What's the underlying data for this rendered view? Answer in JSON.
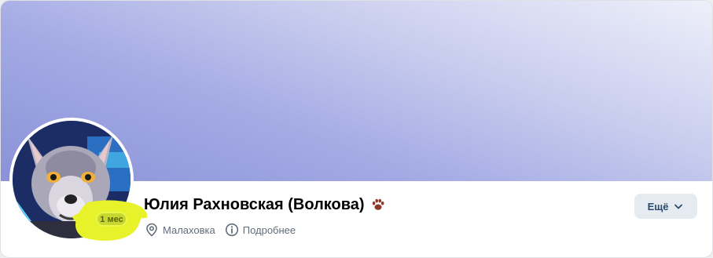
{
  "profile": {
    "name": "Юлия Рахновская (Волкова)",
    "status_badge": "1 мес",
    "location": "Малаховка",
    "details_link": "Подробнее"
  },
  "actions": {
    "more_label": "Ещё"
  },
  "icons": {
    "name_emoji": "paw-icon",
    "location": "location-pin-icon",
    "details": "info-icon",
    "more": "chevron-down-icon"
  },
  "colors": {
    "highlight": "#e8f22a",
    "badge": "#c7d631",
    "more_button_bg": "#e5ebf1",
    "more_button_text": "#2c4a6f",
    "meta_text": "#626d7a"
  }
}
